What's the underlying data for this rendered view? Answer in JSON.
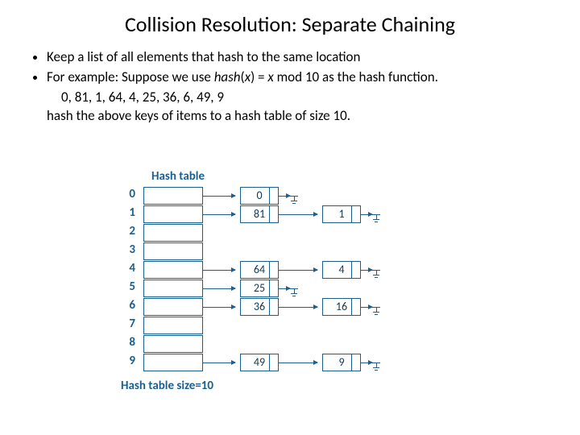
{
  "title": "Collision Resolution: Separate Chaining",
  "bullet1": "Keep a list of all elements that hash to the same location",
  "bullet2_pre": "For example: Suppose we use ",
  "bullet2_fn": "hash",
  "bullet2_paren_open": "(",
  "bullet2_x": "x",
  "bullet2_paren_close": ") = ",
  "bullet2_x2": "x",
  "bullet2_tail": " mod 10 as the hash function.",
  "keys_line": "0, 81, 1, 64, 4, 25, 36, 6, 49, 9",
  "desc_line": "hash the above keys of items to a hash table of size 10.",
  "label_hashtable": "Hash table",
  "label_size": "Hash table size=10",
  "idx": [
    "0",
    "1",
    "2",
    "3",
    "4",
    "5",
    "6",
    "7",
    "8",
    "9"
  ],
  "chains": {
    "0": [
      "0"
    ],
    "1": [
      "81",
      "1"
    ],
    "4": [
      "64",
      "4"
    ],
    "5": [
      "25"
    ],
    "6": [
      "36",
      "16"
    ],
    "9": [
      "49",
      "9"
    ]
  }
}
